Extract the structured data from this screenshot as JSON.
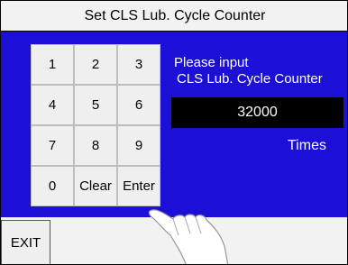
{
  "window": {
    "title": "Set CLS Lub. Cycle Counter"
  },
  "keypad": {
    "keys": [
      "1",
      "2",
      "3",
      "4",
      "5",
      "6",
      "7",
      "8",
      "9",
      "0",
      "Clear",
      "Enter"
    ]
  },
  "prompt": {
    "line1": "Please input",
    "line2": "CLS Lub. Cycle Counter"
  },
  "input": {
    "value": "32000"
  },
  "unit_label": "Times",
  "footer": {
    "exit_label": "EXIT"
  },
  "icons": {
    "pointer": "hand-pointer-icon"
  },
  "colors": {
    "background": "#1c10d6",
    "value_box": "#000000",
    "text_on_blue": "#ffffff"
  }
}
